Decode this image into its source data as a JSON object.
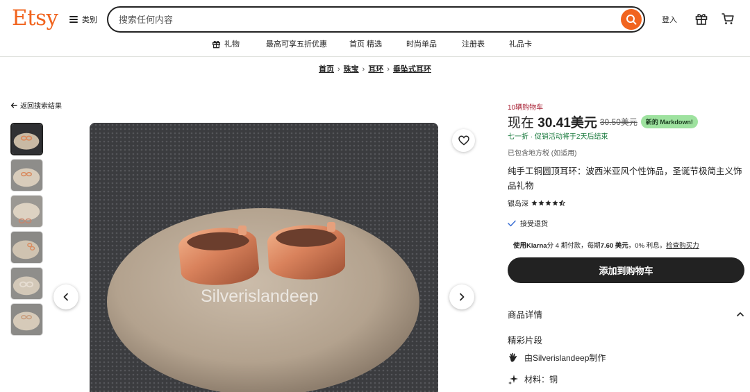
{
  "header": {
    "logo": "Etsy",
    "categories_label": "类别",
    "search_placeholder": "搜索任何内容",
    "signin_label": "登入"
  },
  "subnav": [
    {
      "label": "礼物",
      "icon": "gift-icon"
    },
    {
      "label": "最高可享五折优惠"
    },
    {
      "label": "首页 精选"
    },
    {
      "label": "时尚单品"
    },
    {
      "label": "注册表"
    },
    {
      "label": "礼品卡"
    }
  ],
  "breadcrumb": [
    "首页",
    "珠宝",
    "耳环",
    "垂坠式耳环"
  ],
  "back_label": "返回搜索结果",
  "gallery": {
    "watermark": "Silverislandeep",
    "thumb_count": 6
  },
  "product": {
    "carts_note": "10辆购物车",
    "price_prefix": "现在",
    "price_value": "30.41美元",
    "price_old": "30.50美元",
    "badge": "新的 Markdown!",
    "sale_note": "七一折 · 促销活动将于2天后结束",
    "tax_note": "已包含地方税 (如适用)",
    "title": "纯手工铜圆顶耳环：波西米亚风个性饰品，圣诞节极简主义饰品礼物",
    "shop_name": "银岛深",
    "rating": 4.5,
    "returns": "接受退货",
    "klarna_lead": "使用",
    "klarna_brand": "Klarna",
    "klarna_text_1": "分 4 期付款，每期",
    "klarna_amount": "7.60 美元",
    "klarna_text_2": "，0% 利息。",
    "klarna_link": "检查购买力",
    "add_to_cart": "添加到购物车",
    "details_header": "商品详情",
    "highlights_title": "精彩片段",
    "made_by": "由Silverislandeep制作",
    "material": "材料：铜"
  },
  "colors": {
    "brand": "#f1641e",
    "badge_bg": "#9ee29f",
    "sale_green": "#1a7a3e",
    "carts_red": "#a61a2e"
  }
}
